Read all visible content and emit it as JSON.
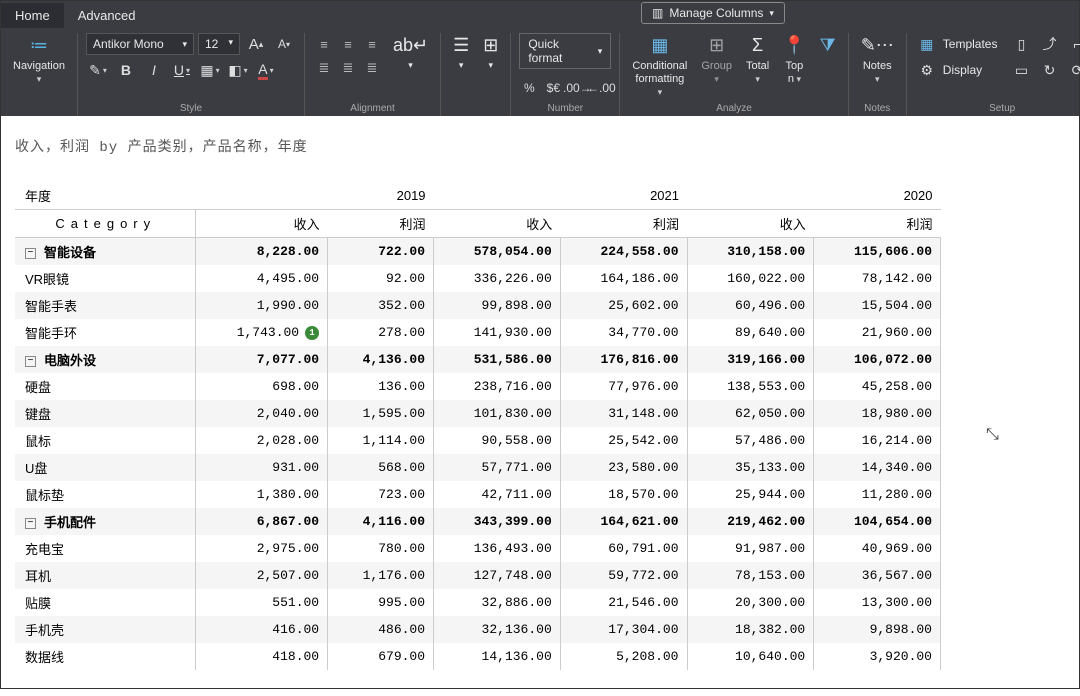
{
  "tabs": {
    "home": "Home",
    "advanced": "Advanced"
  },
  "manage_columns": "Manage Columns",
  "groups": {
    "style": "Style",
    "alignment": "Alignment",
    "number": "Number",
    "analyze": "Analyze",
    "notes": "Notes",
    "setup": "Setup"
  },
  "navigation": "Navigation",
  "font": {
    "name": "Antikor Mono",
    "size": "12"
  },
  "quick_format": "Quick format",
  "cond_fmt": "Conditional formatting",
  "group_btn": "Group",
  "total": "Total",
  "topn": "Top n",
  "notes": "Notes",
  "templates": "Templates",
  "display": "Display",
  "title": "收入，利润 by 产品类别，产品名称，年度",
  "year_label": "年度",
  "category_label": "Category",
  "years": [
    "2019",
    "2021",
    "2020"
  ],
  "metrics": {
    "revenue": "收入",
    "profit": "利润"
  },
  "badge_value": "1",
  "sections": [
    {
      "name": "智能设备",
      "totals": [
        "8,228.00",
        "722.00",
        "578,054.00",
        "224,558.00",
        "310,158.00",
        "115,606.00"
      ],
      "rows": [
        {
          "name": "VR眼镜",
          "v": [
            "4,495.00",
            "92.00",
            "336,226.00",
            "164,186.00",
            "160,022.00",
            "78,142.00"
          ]
        },
        {
          "name": "智能手表",
          "v": [
            "1,990.00",
            "352.00",
            "99,898.00",
            "25,602.00",
            "60,496.00",
            "15,504.00"
          ]
        },
        {
          "name": "智能手环",
          "v": [
            "1,743.00",
            "278.00",
            "141,930.00",
            "34,770.00",
            "89,640.00",
            "21,960.00"
          ],
          "badge": true
        }
      ]
    },
    {
      "name": "电脑外设",
      "totals": [
        "7,077.00",
        "4,136.00",
        "531,586.00",
        "176,816.00",
        "319,166.00",
        "106,072.00"
      ],
      "rows": [
        {
          "name": "硬盘",
          "v": [
            "698.00",
            "136.00",
            "238,716.00",
            "77,976.00",
            "138,553.00",
            "45,258.00"
          ]
        },
        {
          "name": "键盘",
          "v": [
            "2,040.00",
            "1,595.00",
            "101,830.00",
            "31,148.00",
            "62,050.00",
            "18,980.00"
          ]
        },
        {
          "name": "鼠标",
          "v": [
            "2,028.00",
            "1,114.00",
            "90,558.00",
            "25,542.00",
            "57,486.00",
            "16,214.00"
          ]
        },
        {
          "name": "U盘",
          "v": [
            "931.00",
            "568.00",
            "57,771.00",
            "23,580.00",
            "35,133.00",
            "14,340.00"
          ]
        },
        {
          "name": "鼠标垫",
          "v": [
            "1,380.00",
            "723.00",
            "42,711.00",
            "18,570.00",
            "25,944.00",
            "11,280.00"
          ]
        }
      ]
    },
    {
      "name": "手机配件",
      "totals": [
        "6,867.00",
        "4,116.00",
        "343,399.00",
        "164,621.00",
        "219,462.00",
        "104,654.00"
      ],
      "rows": [
        {
          "name": "充电宝",
          "v": [
            "2,975.00",
            "780.00",
            "136,493.00",
            "60,791.00",
            "91,987.00",
            "40,969.00"
          ]
        },
        {
          "name": "耳机",
          "v": [
            "2,507.00",
            "1,176.00",
            "127,748.00",
            "59,772.00",
            "78,153.00",
            "36,567.00"
          ]
        },
        {
          "name": "贴膜",
          "v": [
            "551.00",
            "995.00",
            "32,886.00",
            "21,546.00",
            "20,300.00",
            "13,300.00"
          ]
        },
        {
          "name": "手机壳",
          "v": [
            "416.00",
            "486.00",
            "32,136.00",
            "17,304.00",
            "18,382.00",
            "9,898.00"
          ]
        },
        {
          "name": "数据线",
          "v": [
            "418.00",
            "679.00",
            "14,136.00",
            "5,208.00",
            "10,640.00",
            "3,920.00"
          ]
        }
      ]
    }
  ]
}
